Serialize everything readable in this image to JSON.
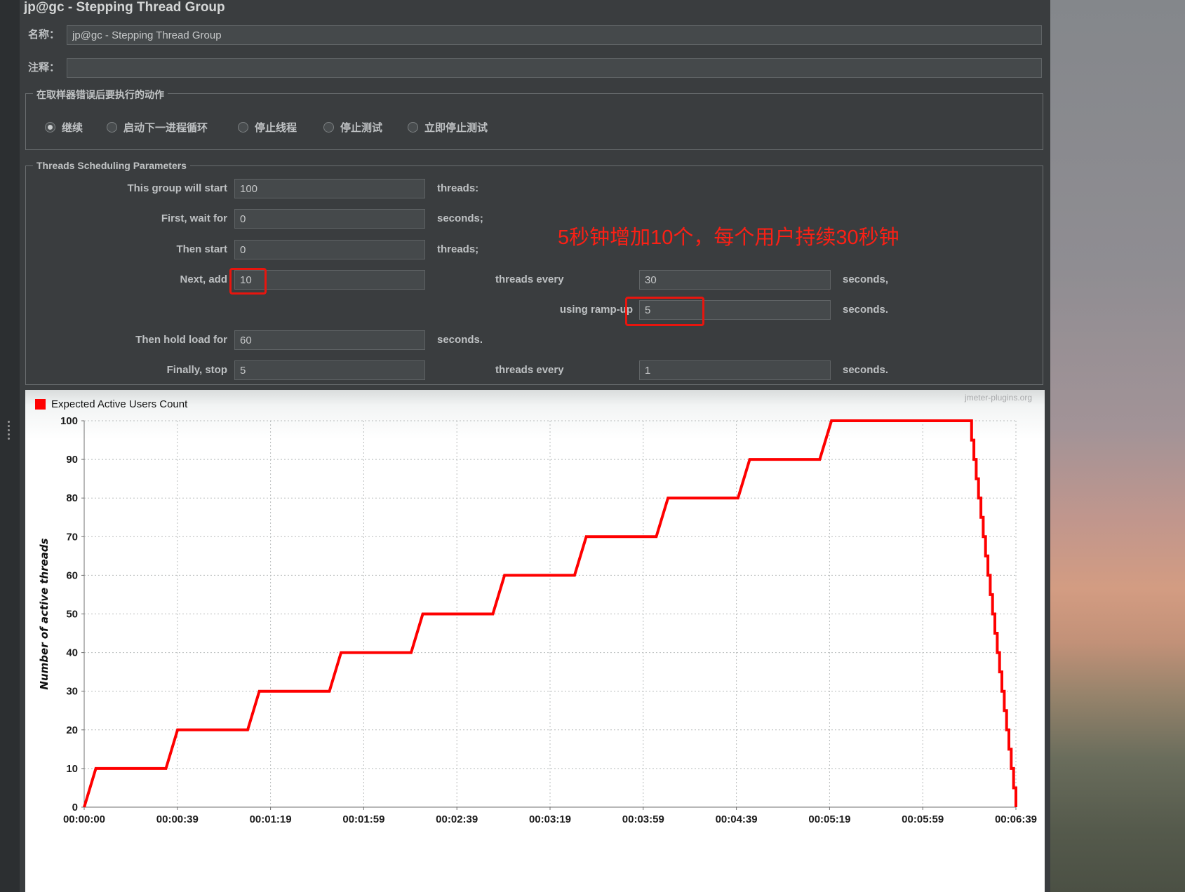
{
  "window": {
    "title": "jp@gc - Stepping Thread Group"
  },
  "form": {
    "name_label": "名称：",
    "name_value": "jp@gc - Stepping Thread Group",
    "comment_label": "注释：",
    "comment_value": "",
    "error_action": {
      "legend": "在取样器错误后要执行的动作",
      "options": [
        {
          "label": "继续",
          "selected": true
        },
        {
          "label": "启动下一进程循环",
          "selected": false
        },
        {
          "label": "停止线程",
          "selected": false
        },
        {
          "label": "停止测试",
          "selected": false
        },
        {
          "label": "立即停止测试",
          "selected": false
        }
      ]
    }
  },
  "scheduling": {
    "legend": "Threads Scheduling Parameters",
    "annotation": "5秒钟增加10个，每个用户持续30秒钟",
    "group_start": {
      "label": "This group will start",
      "value": "100",
      "unit": "threads:"
    },
    "first_wait": {
      "label": "First, wait for",
      "value": "0",
      "unit": "seconds;"
    },
    "then_start": {
      "label": "Then start",
      "value": "0",
      "unit": "threads;"
    },
    "next_add": {
      "label": "Next, add",
      "value": "10",
      "mid": "threads every",
      "value2": "30",
      "unit": "seconds,"
    },
    "ramp_up": {
      "label": "using ramp-up",
      "value": "5",
      "unit": "seconds."
    },
    "hold": {
      "label": "Then hold load for",
      "value": "60",
      "unit": "seconds."
    },
    "stop": {
      "label": "Finally, stop",
      "value": "5",
      "mid": "threads every",
      "value2": "1",
      "unit": "seconds."
    }
  },
  "chart_data": {
    "type": "line",
    "title": "Expected Active Users Count",
    "watermark": "jmeter-plugins.org",
    "ylabel": "Number of active threads",
    "xlim": [
      0,
      399
    ],
    "ylim": [
      0,
      100
    ],
    "grid": true,
    "legend_position": "top-left",
    "yticks": [
      0,
      10,
      20,
      30,
      40,
      50,
      60,
      70,
      80,
      90,
      100
    ],
    "xtick_labels": [
      "00:00:00",
      "00:00:39",
      "00:01:19",
      "00:01:59",
      "00:02:39",
      "00:03:19",
      "00:03:59",
      "00:04:39",
      "00:05:19",
      "00:05:59",
      "00:06:39"
    ],
    "series": [
      {
        "name": "Expected Active Users Count",
        "color": "#fe0000",
        "points": [
          [
            0,
            0
          ],
          [
            5,
            10
          ],
          [
            35,
            10
          ],
          [
            40,
            20
          ],
          [
            70,
            20
          ],
          [
            75,
            30
          ],
          [
            105,
            30
          ],
          [
            110,
            40
          ],
          [
            140,
            40
          ],
          [
            145,
            50
          ],
          [
            175,
            50
          ],
          [
            180,
            60
          ],
          [
            210,
            60
          ],
          [
            215,
            70
          ],
          [
            245,
            70
          ],
          [
            250,
            80
          ],
          [
            280,
            80
          ],
          [
            285,
            90
          ],
          [
            315,
            90
          ],
          [
            320,
            100
          ],
          [
            380,
            100
          ],
          [
            380,
            95
          ],
          [
            381,
            95
          ],
          [
            381,
            90
          ],
          [
            382,
            90
          ],
          [
            382,
            85
          ],
          [
            383,
            85
          ],
          [
            383,
            80
          ],
          [
            384,
            80
          ],
          [
            384,
            75
          ],
          [
            385,
            75
          ],
          [
            385,
            70
          ],
          [
            386,
            70
          ],
          [
            386,
            65
          ],
          [
            387,
            65
          ],
          [
            387,
            60
          ],
          [
            388,
            60
          ],
          [
            388,
            55
          ],
          [
            389,
            55
          ],
          [
            389,
            50
          ],
          [
            390,
            50
          ],
          [
            390,
            45
          ],
          [
            391,
            45
          ],
          [
            391,
            40
          ],
          [
            392,
            40
          ],
          [
            392,
            35
          ],
          [
            393,
            35
          ],
          [
            393,
            30
          ],
          [
            394,
            30
          ],
          [
            394,
            25
          ],
          [
            395,
            25
          ],
          [
            395,
            20
          ],
          [
            396,
            20
          ],
          [
            396,
            15
          ],
          [
            397,
            15
          ],
          [
            397,
            10
          ],
          [
            398,
            10
          ],
          [
            398,
            5
          ],
          [
            399,
            5
          ],
          [
            399,
            0
          ]
        ]
      }
    ]
  }
}
